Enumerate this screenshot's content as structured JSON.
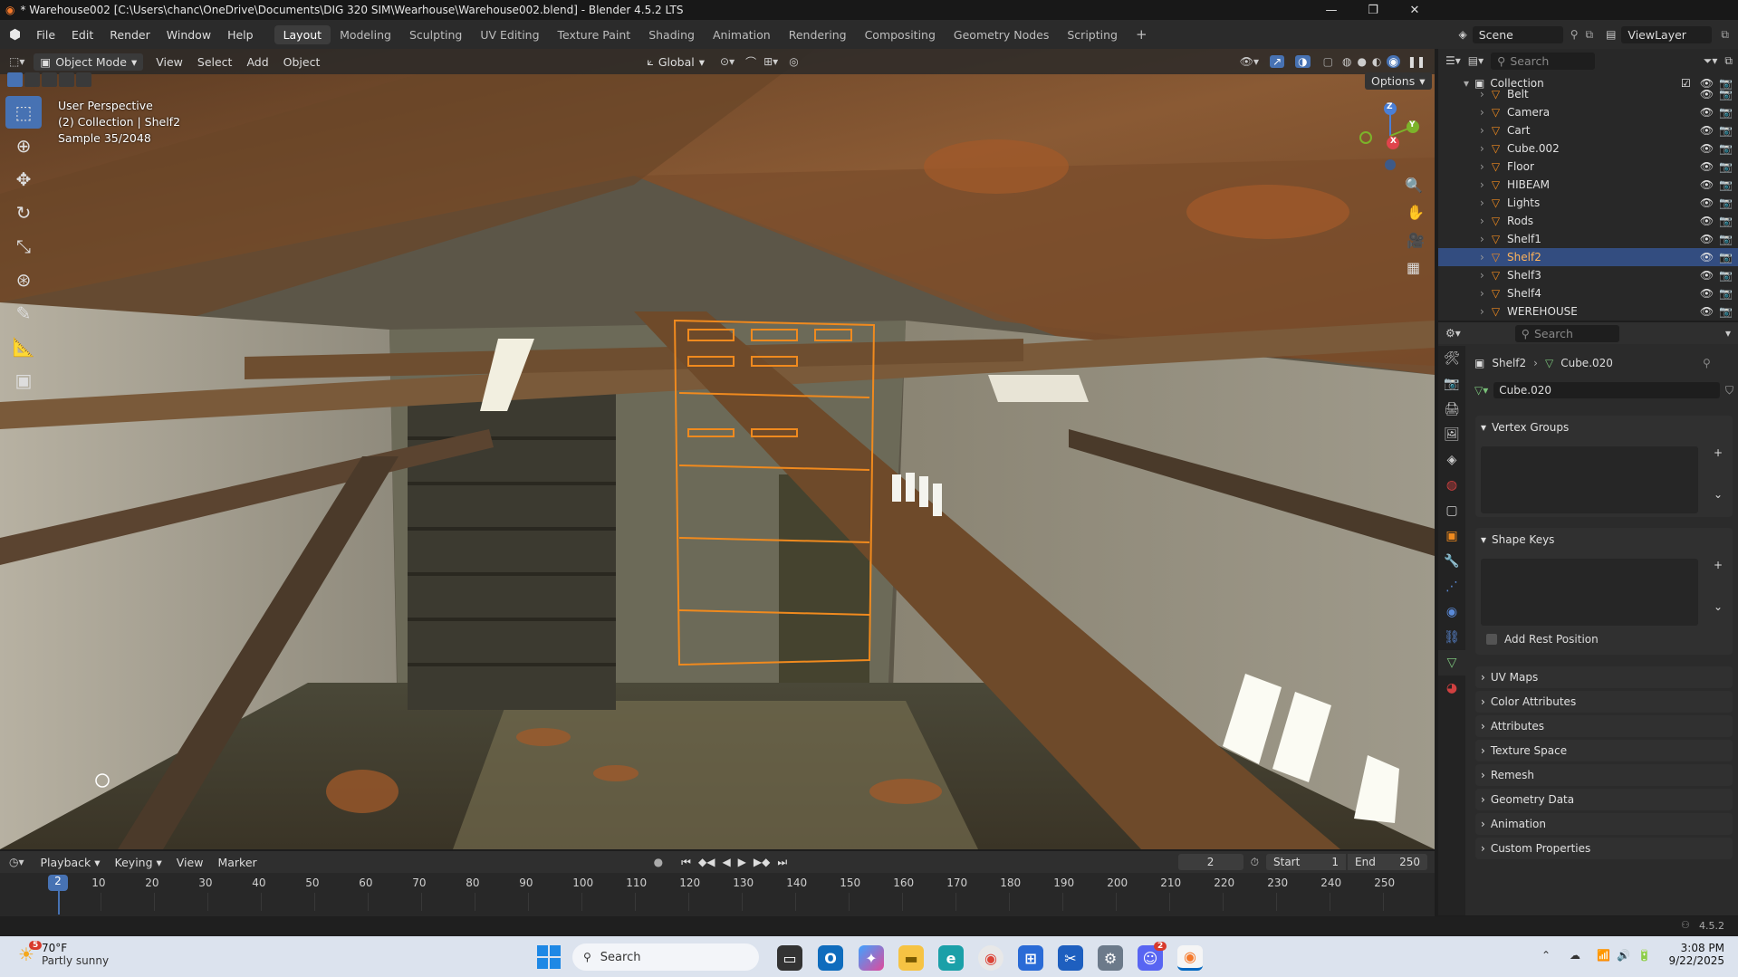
{
  "app": {
    "title": "* Warehouse002 [C:\\Users\\chanc\\OneDrive\\Documents\\DIG 320 SIM\\Wearhouse\\Warehouse002.blend] - Blender 4.5.2 LTS"
  },
  "menus": [
    "File",
    "Edit",
    "Render",
    "Window",
    "Help"
  ],
  "workspaces": [
    "Layout",
    "Modeling",
    "Sculpting",
    "UV Editing",
    "Texture Paint",
    "Shading",
    "Animation",
    "Rendering",
    "Compositing",
    "Geometry Nodes",
    "Scripting"
  ],
  "scene": {
    "label": "Scene",
    "view_layer": "ViewLayer"
  },
  "viewport": {
    "mode": "Object Mode",
    "menus": [
      "View",
      "Select",
      "Add",
      "Object"
    ],
    "transform": "Global",
    "options": "Options",
    "info": {
      "perspective": "User Perspective",
      "collection": "(2) Collection | Shelf2",
      "sample": "Sample 35/2048"
    },
    "gizmo": {
      "z": "Z",
      "y": "Y",
      "x": "X"
    }
  },
  "outliner": {
    "search_placeholder": "Search",
    "collection": "Collection",
    "items": [
      {
        "name": "Belt",
        "selected": false
      },
      {
        "name": "Camera",
        "selected": false
      },
      {
        "name": "Cart",
        "selected": false
      },
      {
        "name": "Cube.002",
        "selected": false
      },
      {
        "name": "Floor",
        "selected": false
      },
      {
        "name": "HIBEAM",
        "selected": false
      },
      {
        "name": "Lights",
        "selected": false
      },
      {
        "name": "Rods",
        "selected": false
      },
      {
        "name": "Shelf1",
        "selected": false
      },
      {
        "name": "Shelf2",
        "selected": true
      },
      {
        "name": "Shelf3",
        "selected": false
      },
      {
        "name": "Shelf4",
        "selected": false
      },
      {
        "name": "WEREHOUSE",
        "selected": false
      }
    ]
  },
  "properties": {
    "search_placeholder": "Search",
    "breadcrumb_object": "Shelf2",
    "breadcrumb_data": "Cube.020",
    "mesh_name": "Cube.020",
    "vertex_groups": "Vertex Groups",
    "shape_keys": "Shape Keys",
    "add_rest_position": "Add Rest Position",
    "collapsed_panels": [
      "UV Maps",
      "Color Attributes",
      "Attributes",
      "Texture Space",
      "Remesh",
      "Geometry Data",
      "Animation",
      "Custom Properties"
    ]
  },
  "timeline": {
    "menus": [
      "Playback",
      "Keying",
      "View",
      "Marker"
    ],
    "current_frame": "2",
    "start_label": "Start",
    "start": "1",
    "end_label": "End",
    "end": "250",
    "ruler": [
      "10",
      "20",
      "30",
      "40",
      "50",
      "60",
      "70",
      "80",
      "90",
      "100",
      "110",
      "120",
      "130",
      "140",
      "150",
      "160",
      "170",
      "180",
      "190",
      "200",
      "210",
      "220",
      "230",
      "240",
      "250"
    ],
    "playhead": "2"
  },
  "statusbar": {
    "version": "4.5.2"
  },
  "taskbar": {
    "weather_temp": "70°F",
    "weather_desc": "Partly sunny",
    "weather_badge": "5",
    "search_placeholder": "Search",
    "time": "3:08 PM",
    "date": "9/22/2025",
    "discord_badge": "2"
  },
  "colors": {
    "selection": "#334d80",
    "accent": "#4772b3",
    "outline_orange": "#f08a1e",
    "timeline_playhead": "#4772b3"
  }
}
